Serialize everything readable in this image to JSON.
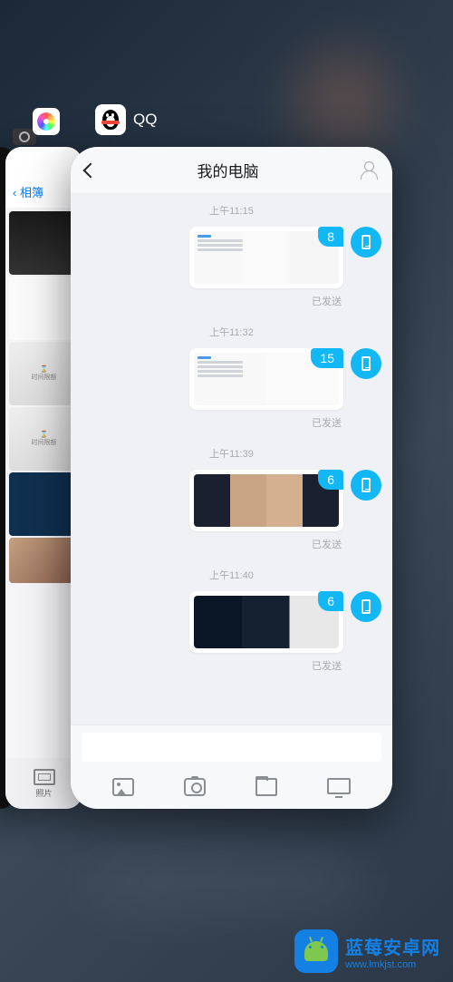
{
  "switcher": {
    "apps": {
      "camera": {
        "name": "camera"
      },
      "photos": {
        "name": "photos",
        "header_back": "相簿",
        "bottom_label": "照片"
      },
      "qq": {
        "name": "QQ"
      }
    }
  },
  "qq_chat": {
    "title": "我的电脑",
    "messages": [
      {
        "time": "上午11:15",
        "count": "8",
        "status": "已发送",
        "thumb": "files1"
      },
      {
        "time": "上午11:32",
        "count": "15",
        "status": "已发送",
        "thumb": "files2"
      },
      {
        "time": "上午11:39",
        "count": "6",
        "status": "已发送",
        "thumb": "photos1"
      },
      {
        "time": "上午11:40",
        "count": "6",
        "status": "已发送",
        "thumb": "photos2"
      }
    ],
    "toolbar": [
      "gallery",
      "camera",
      "folder",
      "screen"
    ]
  },
  "watermark": {
    "title": "蓝莓安卓网",
    "url": "www.lmkjst.com"
  },
  "colors": {
    "qq_blue": "#12b7f5",
    "ios_blue": "#007aff",
    "wm_blue": "#1580e4"
  }
}
